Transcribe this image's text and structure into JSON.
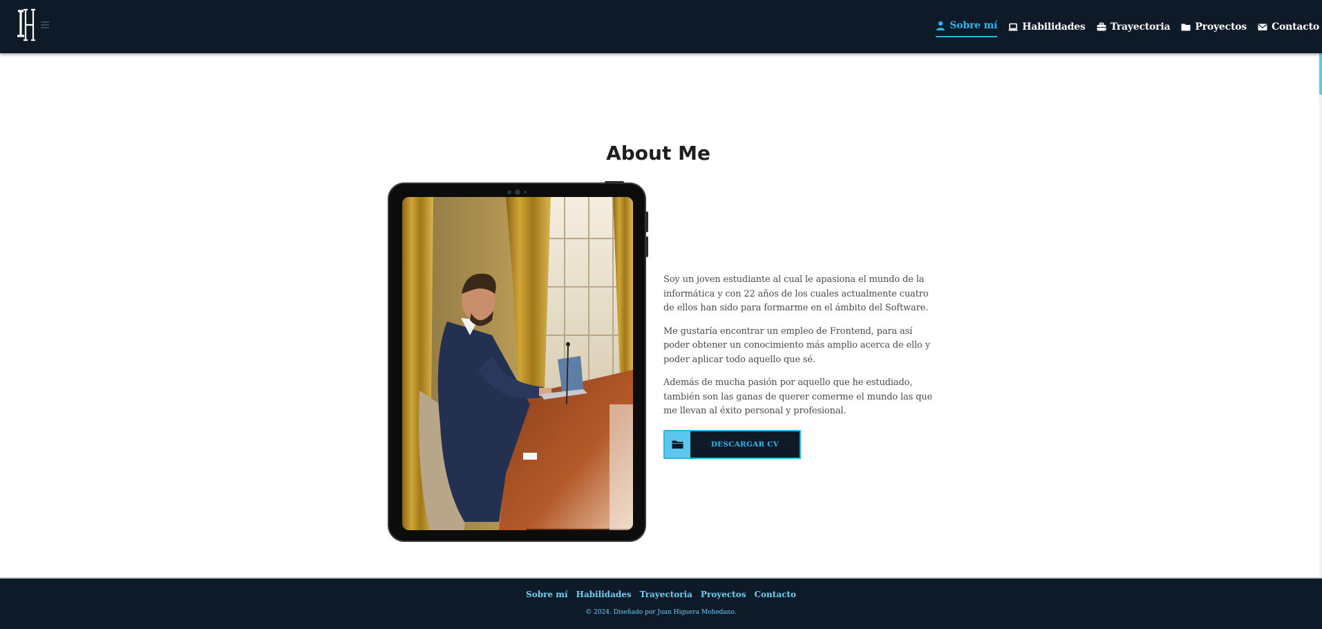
{
  "header": {
    "logo_text": "JH",
    "nav": [
      {
        "label": "Sobre mí",
        "icon": "user-icon",
        "active": true
      },
      {
        "label": "Habilidades",
        "icon": "laptop-icon",
        "active": false
      },
      {
        "label": "Trayectoria",
        "icon": "briefcase-icon",
        "active": false
      },
      {
        "label": "Proyectos",
        "icon": "folder-icon",
        "active": false
      },
      {
        "label": "Contacto",
        "icon": "envelope-icon",
        "active": false
      }
    ]
  },
  "about": {
    "title": "About Me",
    "paragraphs": [
      "Soy un joven estudiante al cual le apasiona el mundo de la informática y con 22 años de los cuales actualmente cuatro de ellos han sido para formarme en el ámbito del Software.",
      "Me gustaría encontrar un empleo de Frontend, para así poder obtener un conocimiento más amplio acerca de ello y poder aplicar todo aquello que sé.",
      "Además de mucha pasión por aquello que he estudiado, también son las ganas de querer comerme el mundo las que me llevan al éxito personal y profesional."
    ],
    "cv_button": {
      "label": "DESCARGAR CV",
      "icon": "folder-icon"
    }
  },
  "footer": {
    "links": [
      "Sobre mí",
      "Habilidades",
      "Trayectoria",
      "Proyectos",
      "Contacto"
    ],
    "copyright": "© 2024. Diseñado por Juan Higuera Mohedano."
  },
  "colors": {
    "navy": "#0f1a28",
    "accent": "#29b6e8",
    "accent_light": "#5cc7ee"
  }
}
